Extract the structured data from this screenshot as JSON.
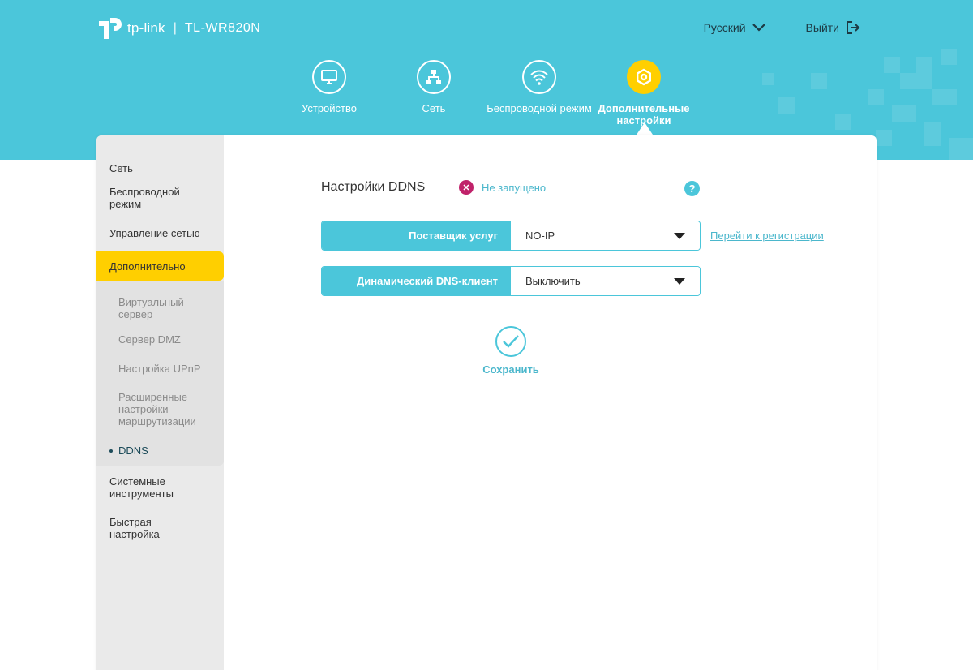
{
  "header": {
    "brand": "tp-link",
    "separator": "|",
    "model": "TL-WR820N",
    "language": "Русский",
    "logout": "Выйти"
  },
  "nav": {
    "items": [
      {
        "label": "Устройство",
        "icon": "monitor-icon"
      },
      {
        "label": "Сеть",
        "icon": "network-icon"
      },
      {
        "label": "Беспроводной режим",
        "icon": "wifi-icon"
      },
      {
        "label": "Дополнительные настройки",
        "icon": "gear-icon",
        "active": true
      }
    ]
  },
  "sidebar": {
    "items": [
      "Сеть",
      "Беспроводной режим",
      "Управление сетью"
    ],
    "active": "Дополнительно",
    "submenu": [
      "Виртуальный сервер",
      "Сервер DMZ",
      "Настройка UPnP",
      "Расширенные настройки маршрутизации",
      "DDNS"
    ],
    "bottom_items": [
      "Системные инструменты",
      "Быстрая настройка"
    ]
  },
  "main": {
    "title": "Настройки DDNS",
    "status": "Не запущено",
    "help": "?",
    "provider_label": "Поставщик услуг",
    "provider_value": "NO-IP",
    "register_link": "Перейти к регистрации",
    "client_label": "Динамический DNS-клиент",
    "client_value": "Выключить",
    "save_label": "Сохранить"
  },
  "colors": {
    "accent": "#4bc6da",
    "active": "#ffcf00",
    "error": "#c0226a"
  }
}
